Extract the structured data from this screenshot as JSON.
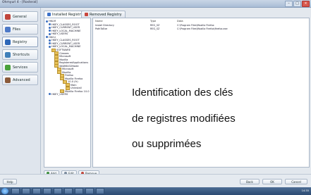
{
  "window": {
    "title": "Ohmyurl 4 - [Rosteral]"
  },
  "sidebar": {
    "items": [
      {
        "label": "General",
        "icon": "home-icon",
        "color": "#c0453b"
      },
      {
        "label": "Files",
        "icon": "folder-icon",
        "color": "#4d79c7"
      },
      {
        "label": "Registry",
        "icon": "registry-icon",
        "color": "#2d67b8"
      },
      {
        "label": "Shortcuts",
        "icon": "shortcut-icon",
        "color": "#3f7fb9"
      },
      {
        "label": "Services",
        "icon": "gear-icon",
        "color": "#4aa13b"
      },
      {
        "label": "Advanced",
        "icon": "tools-icon",
        "color": "#8b5a3a"
      }
    ]
  },
  "tabs": [
    {
      "label": "Installed Registry",
      "icon": "registry-icon"
    },
    {
      "label": "Removed Registry",
      "icon": "registry-icon"
    }
  ],
  "tree": {
    "nodes": [
      {
        "label": "HKLM",
        "icon": "computer-icon"
      },
      {
        "label": "HKEY_CLASSES_ROOT",
        "icon": "hive-icon"
      },
      {
        "label": "HKEY_CURRENT_USER",
        "icon": "hive-icon"
      },
      {
        "label": "HKEY_LOCAL_MACHINE",
        "icon": "hive-icon"
      },
      {
        "label": "HKEY_USERS",
        "icon": "hive-icon"
      },
      {
        "label": "HKCU",
        "icon": "computer-icon"
      },
      {
        "label": "HKEY_CLASSES_ROOT",
        "icon": "hive-icon"
      },
      {
        "label": "HKEY_CURRENT_USER",
        "icon": "hive-icon"
      },
      {
        "label": "HKEY_LOCAL_MACHINE",
        "icon": "hive-icon"
      },
      {
        "label": "SOFTWARE",
        "icon": "folder-icon"
      },
      {
        "label": "Classes",
        "icon": "folder-icon"
      },
      {
        "label": "Microsoft",
        "icon": "folder-icon"
      },
      {
        "label": "Mozilla",
        "icon": "folder-icon"
      },
      {
        "label": "RegisteredApplications",
        "icon": "folder-icon"
      },
      {
        "label": "WoW6432Node",
        "icon": "folder-icon"
      },
      {
        "label": "Microsoft",
        "icon": "folder-icon"
      },
      {
        "label": "Mozilla",
        "icon": "folder-icon"
      },
      {
        "label": "Firefox",
        "icon": "folder-icon"
      },
      {
        "label": "Mozilla Firefox",
        "icon": "folder-icon"
      },
      {
        "label": "10.0 (fr)",
        "icon": "folder-icon"
      },
      {
        "label": "Main",
        "icon": "folder-icon"
      },
      {
        "label": "Uninstall",
        "icon": "folder-icon"
      },
      {
        "label": "Mozilla Firefox 10.0",
        "icon": "folder-icon"
      },
      {
        "label": "HKEY_USERS",
        "icon": "hive-icon"
      }
    ]
  },
  "list": {
    "columns": [
      "Name",
      "Type",
      "Data"
    ],
    "rows": [
      {
        "name": "Install Directory",
        "type": "REG_SZ",
        "data": "C:\\Program Files\\Mozilla Firefox"
      },
      {
        "name": "PathToExe",
        "type": "REG_SZ",
        "data": "C:\\Program Files\\Mozilla Firefox\\firefox.exe"
      }
    ]
  },
  "overlay": {
    "line1": "Identification des clés",
    "line2": "de registres modifiées",
    "line3": "ou supprimées"
  },
  "bottom_buttons": [
    {
      "label": "Add",
      "icon": "add-icon",
      "color": "#3b8f3b"
    },
    {
      "label": "Edit",
      "icon": "edit-icon",
      "color": "#7a8a9c"
    },
    {
      "label": "Remove",
      "icon": "remove-icon",
      "color": "#c0453b"
    }
  ],
  "footer": {
    "help_label": "Help",
    "buttons": [
      "Back",
      "OK",
      "Cancel"
    ]
  },
  "taskbar": {
    "clock": "14:35"
  }
}
